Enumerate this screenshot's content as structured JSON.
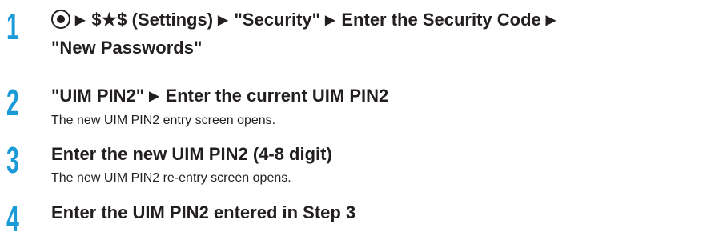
{
  "steps": [
    {
      "number": "1",
      "line1": {
        "settings": "$★$ (Settings)",
        "security": "\"Security\"",
        "enter_code": "Enter the Security Code"
      },
      "line2": "\"New Passwords\""
    },
    {
      "number": "2",
      "line1": {
        "uim_pin2": "\"UIM PIN2\"",
        "enter_current": "Enter the current UIM PIN2"
      },
      "note": "The new UIM PIN2 entry screen opens."
    },
    {
      "number": "3",
      "line1": "Enter the new UIM PIN2 (4-8 digit)",
      "note": "The new UIM PIN2 re-entry screen opens."
    },
    {
      "number": "4",
      "line1": "Enter the UIM PIN2 entered in Step 3"
    }
  ],
  "icons": {
    "arrow": "▶"
  },
  "colors": {
    "step_number": "#1a9ad6",
    "text": "#231f20"
  }
}
